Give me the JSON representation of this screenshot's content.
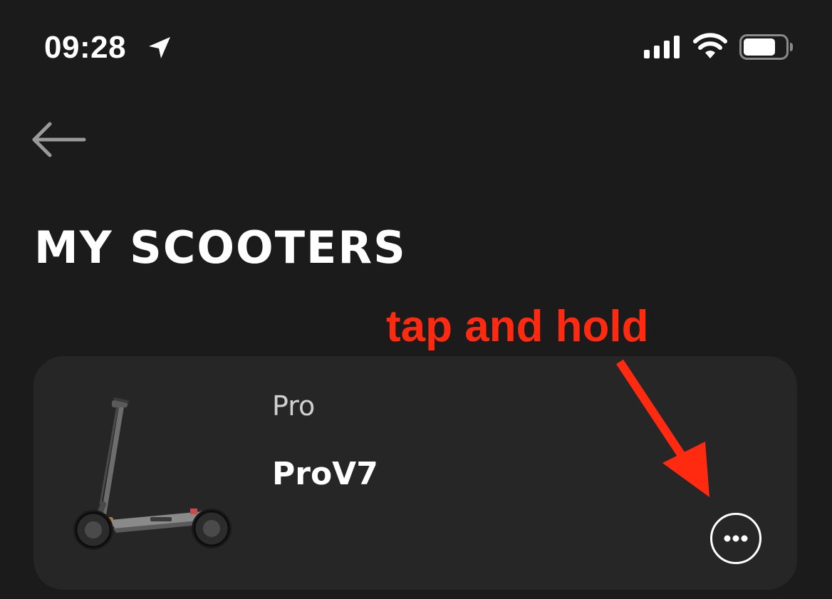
{
  "status_bar": {
    "time": "09:28",
    "icons": [
      "location-arrow-icon",
      "cellular-signal-icon",
      "wifi-icon",
      "battery-icon"
    ]
  },
  "header": {
    "back_icon": "arrow-left-icon",
    "title": "MY SCOOTERS"
  },
  "annotation": {
    "text": "tap and hold",
    "color": "#ff2a10"
  },
  "scooters": [
    {
      "series": "Pro",
      "name": "ProV7",
      "more_icon": "more-horizontal-icon"
    }
  ],
  "colors": {
    "background": "#1b1b1b",
    "card": "#262626",
    "text": "#ffffff",
    "annotation": "#ff2a10"
  }
}
